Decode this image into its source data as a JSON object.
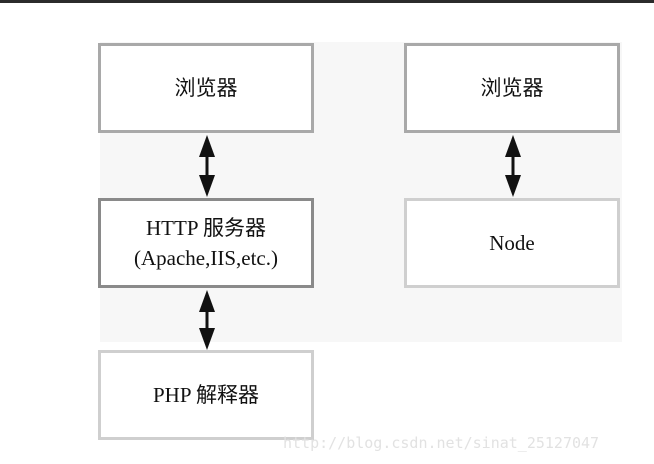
{
  "diagram": {
    "left_column": {
      "browser": "浏览器",
      "http_server_line1": "HTTP 服务器",
      "http_server_line2": "(Apache,IIS,etc.)",
      "php_interpreter": "PHP 解释器"
    },
    "right_column": {
      "browser": "浏览器",
      "node": "Node"
    }
  },
  "watermark": "http://blog.csdn.net/sinat_25127047"
}
